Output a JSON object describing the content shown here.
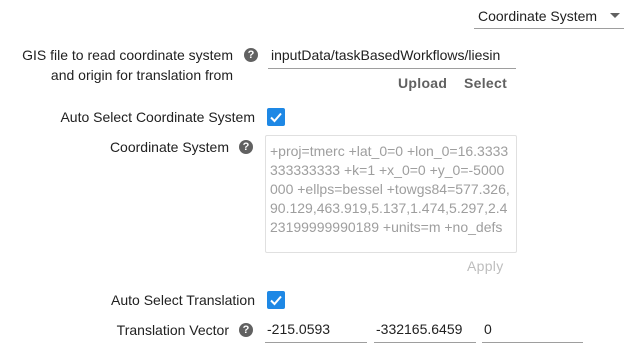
{
  "header": {
    "dropdown_value": "Coordinate System"
  },
  "gis_file": {
    "label_line1": "GIS file to read coordinate system",
    "label_line2": "and origin for translation from",
    "help_icon": "?",
    "value": "inputData/taskBasedWorkflows/liesin",
    "upload_label": "Upload",
    "select_label": "Select"
  },
  "auto_select_cs": {
    "label": "Auto Select Coordinate System",
    "checked": true
  },
  "coordinate_system": {
    "label": "Coordinate System",
    "help_icon": "?",
    "value": "+proj=tmerc +lat_0=0 +lon_0=16.3333333333333 +k=1 +x_0=0 +y_0=-5000000 +ellps=bessel +towgs84=577.326,90.129,463.919,5.137,1.474,5.297,2.423199999990189 +units=m +no_defs",
    "apply_label": "Apply"
  },
  "auto_select_translation": {
    "label": "Auto Select Translation",
    "checked": true
  },
  "translation_vector": {
    "label": "Translation Vector",
    "help_icon": "?",
    "x": "-215.0593",
    "y": "-332165.6459",
    "z": "0"
  },
  "colors": {
    "accent": "#1e88e5",
    "help_icon_bg": "#616161"
  }
}
